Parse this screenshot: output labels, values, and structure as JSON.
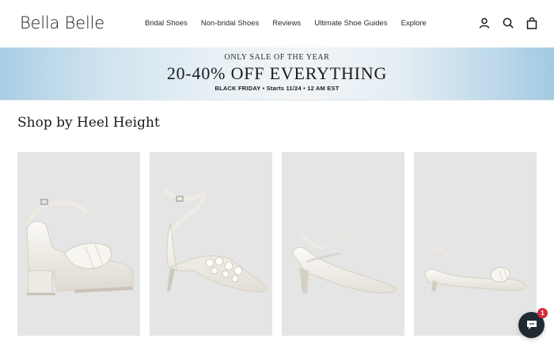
{
  "brand": {
    "name": "Bella Belle"
  },
  "nav": {
    "items": [
      {
        "label": "Bridal Shoes"
      },
      {
        "label": "Non-bridal Shoes"
      },
      {
        "label": "Reviews"
      },
      {
        "label": "Ultimate Shoe Guides"
      },
      {
        "label": "Explore"
      }
    ]
  },
  "header_icons": [
    "account-icon",
    "search-icon",
    "cart-icon"
  ],
  "banner": {
    "kicker": "ONLY SALE OF THE YEAR",
    "headline": "20-40% OFF EVERYTHING",
    "subline": "BLACK FRIDAY  •  Starts 11/24  •  12 AM EST"
  },
  "section": {
    "title": "Shop by Heel Height"
  },
  "products": [
    {
      "icon": "platform-block-heel-sandal-image"
    },
    {
      "icon": "pearl-pointed-pump-image"
    },
    {
      "icon": "crystal-slingback-pump-image"
    },
    {
      "icon": "bow-kitten-heel-slingback-image"
    }
  ],
  "chat": {
    "badge_count": "1"
  },
  "colors": {
    "banner_blue": "#a9cde4",
    "card_bg": "#e5e5e5",
    "chat_bg": "#1f2a33",
    "badge_red": "#d12c3a"
  }
}
